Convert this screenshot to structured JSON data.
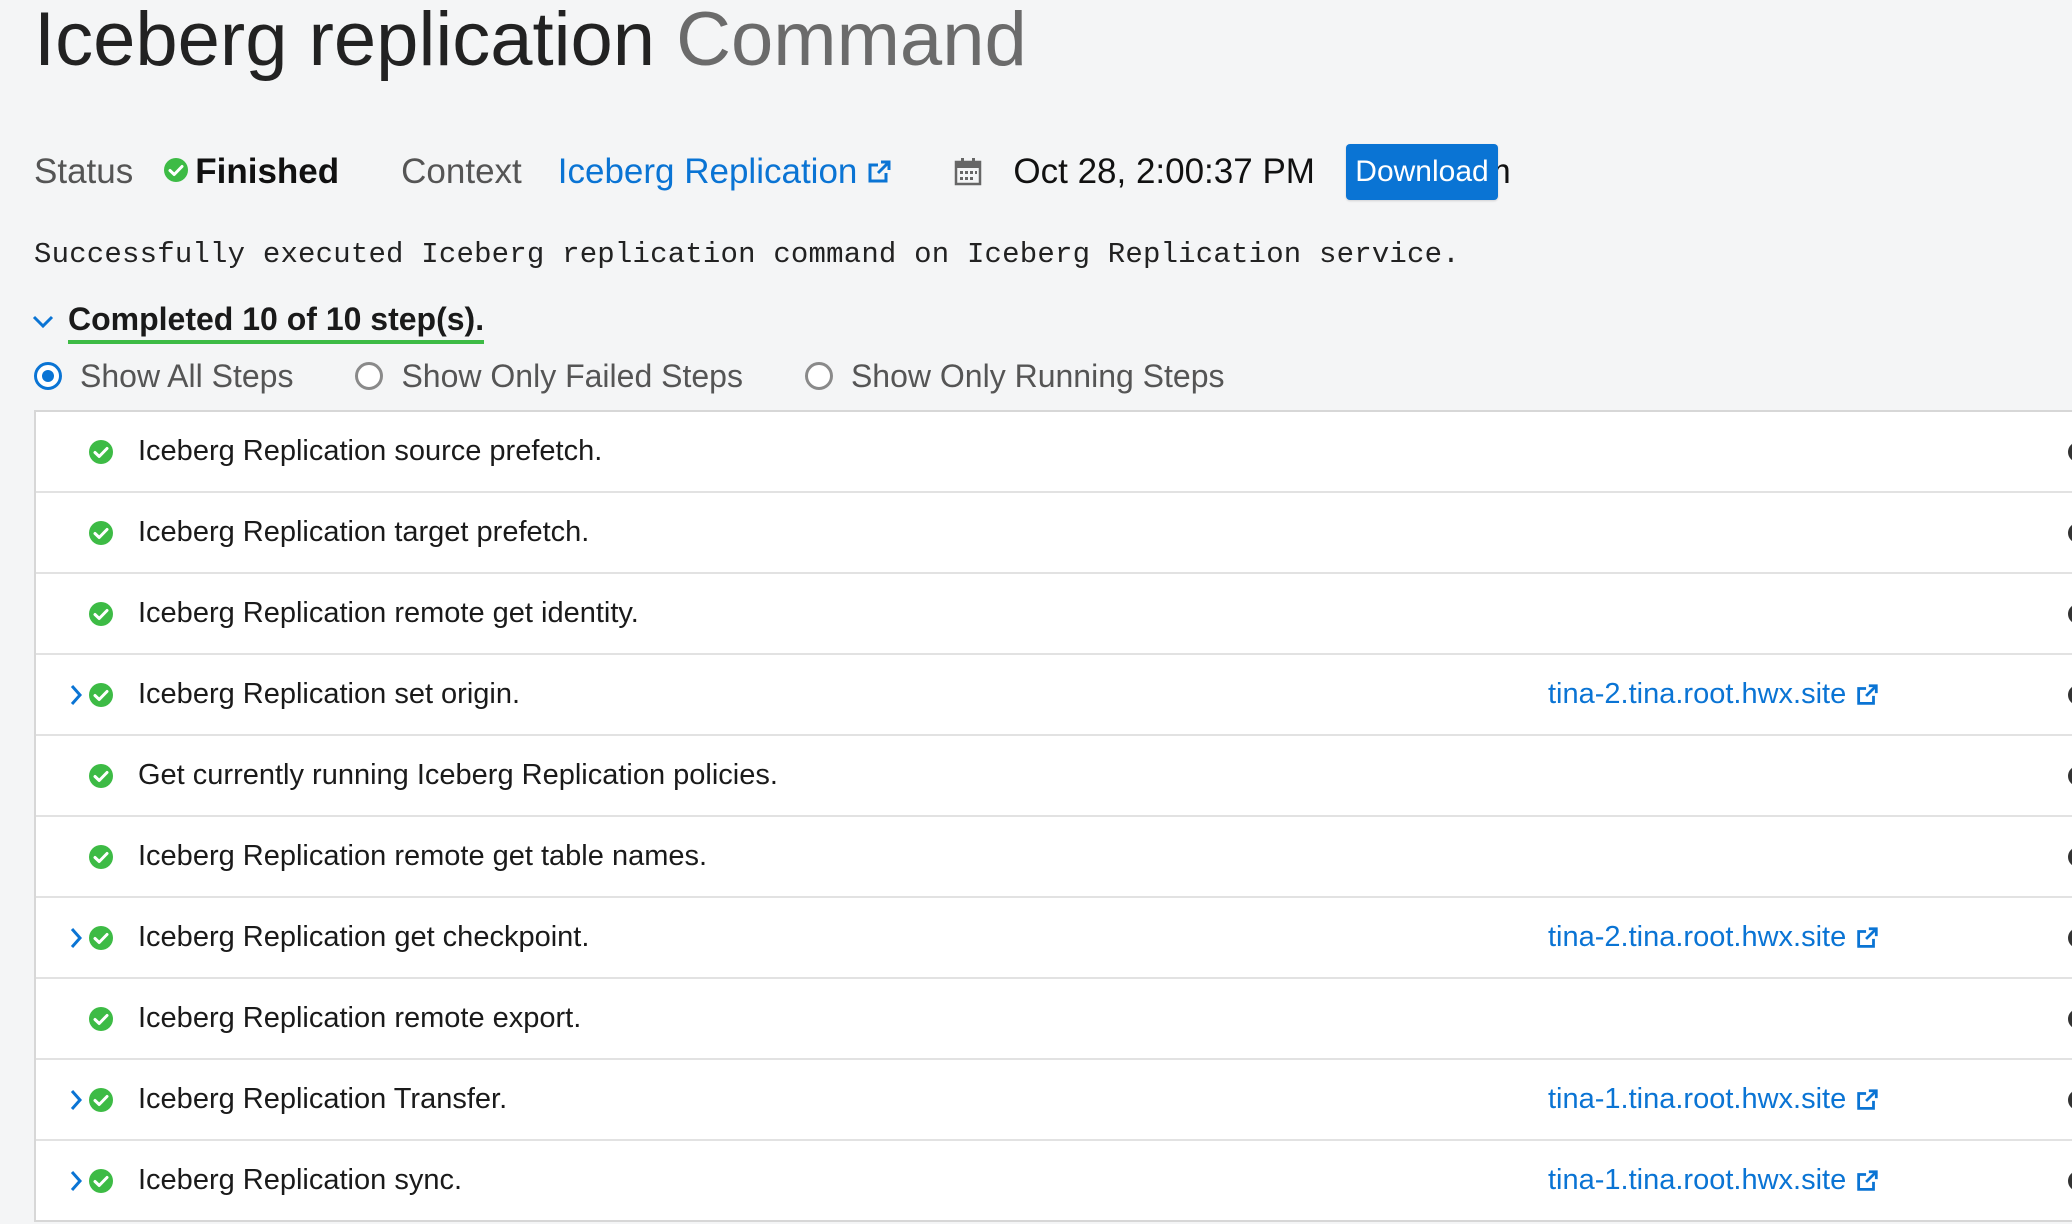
{
  "header": {
    "title_main": "Iceberg replication",
    "title_sub": "Command"
  },
  "meta": {
    "status_label": "Status",
    "status_value": "Finished",
    "context_label": "Context",
    "context_link": "Iceberg Replication",
    "date": "Oct 28, 2:00:37 PM",
    "duration": "2.8m",
    "download_label": "Download"
  },
  "message": "Successfully executed Iceberg replication command on Iceberg Replication service.",
  "summary": {
    "completed_label": "Completed 10 of 10 step(s)."
  },
  "filters": {
    "options": [
      "Show All Steps",
      "Show Only Failed Steps",
      "Show Only Running Steps"
    ],
    "selected": "Show All Steps"
  },
  "steps": [
    {
      "name": "Iceberg Replication source prefetch.",
      "expandable": false,
      "host": ""
    },
    {
      "name": "Iceberg Replication target prefetch.",
      "expandable": false,
      "host": ""
    },
    {
      "name": "Iceberg Replication remote get identity.",
      "expandable": false,
      "host": ""
    },
    {
      "name": "Iceberg Replication set origin.",
      "expandable": true,
      "host": "tina-2.tina.root.hwx.site"
    },
    {
      "name": "Get currently running Iceberg Replication policies.",
      "expandable": false,
      "host": ""
    },
    {
      "name": "Iceberg Replication remote get table names.",
      "expandable": false,
      "host": ""
    },
    {
      "name": "Iceberg Replication get checkpoint.",
      "expandable": true,
      "host": "tina-2.tina.root.hwx.site"
    },
    {
      "name": "Iceberg Replication remote export.",
      "expandable": false,
      "host": ""
    },
    {
      "name": "Iceberg Replication Transfer.",
      "expandable": true,
      "host": "tina-1.tina.root.hwx.site"
    },
    {
      "name": "Iceberg Replication sync.",
      "expandable": true,
      "host": "tina-1.tina.root.hwx.site"
    }
  ],
  "colors": {
    "accent": "#0a74d4",
    "success": "#3dbb45"
  },
  "icons": {
    "status": "check-circle-icon",
    "context": "external-link-icon",
    "date": "calendar-icon",
    "duration": "clock-icon",
    "expander": "chevron-right-icon"
  }
}
